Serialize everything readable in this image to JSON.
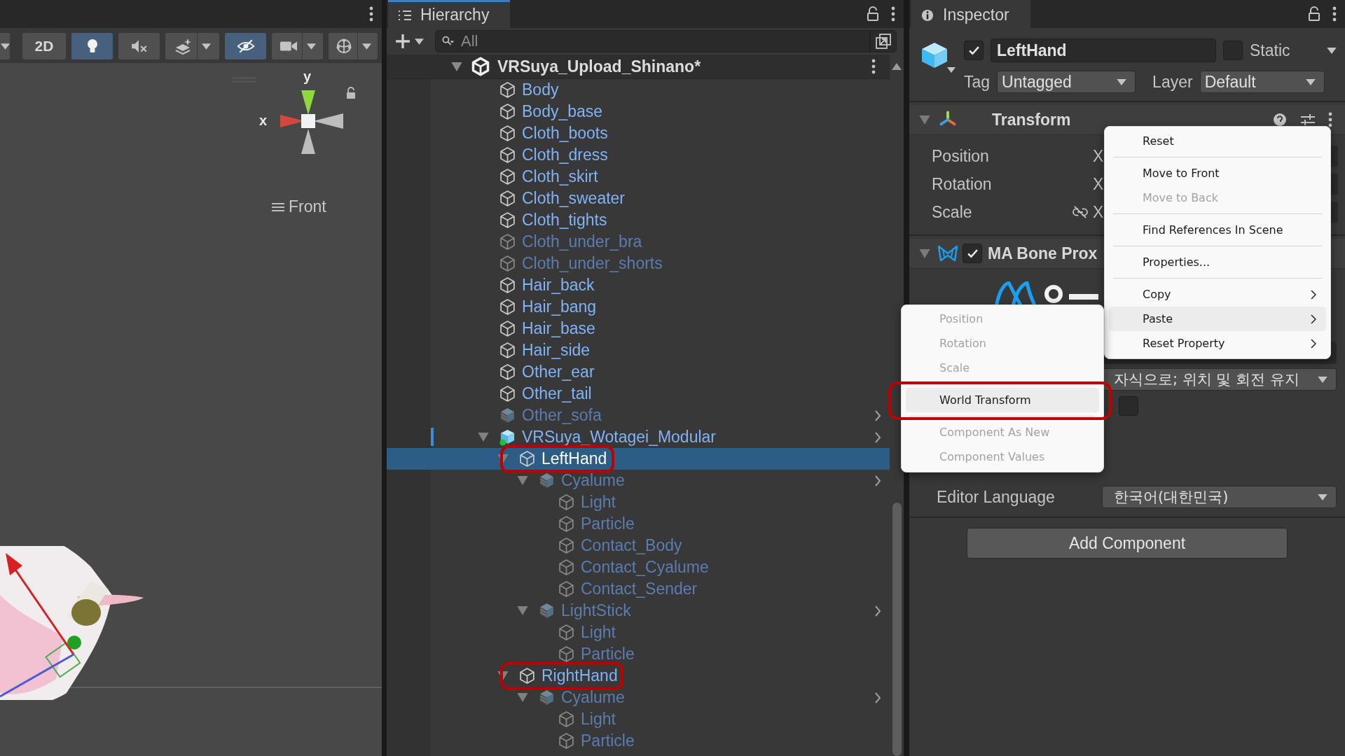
{
  "scene_view": {
    "toolbar": [
      {
        "kind": "caret",
        "on": false,
        "dropdown": true
      },
      {
        "kind": "text",
        "label": "2D",
        "on": false,
        "dropdown": false
      },
      {
        "kind": "light",
        "on": true,
        "dropdown": false
      },
      {
        "kind": "audio",
        "on": false,
        "dropdown": false
      },
      {
        "kind": "effects",
        "on": false,
        "dropdown": true
      },
      {
        "kind": "visibility",
        "on": true,
        "dropdown": false
      },
      {
        "kind": "camera",
        "on": false,
        "dropdown": true
      },
      {
        "kind": "gizmos",
        "on": false,
        "dropdown": true
      }
    ],
    "gizmo": {
      "y_label": "y",
      "x_label": "x",
      "view": "Front"
    }
  },
  "hierarchy": {
    "title": "Hierarchy",
    "focused": true,
    "search": {
      "placeholder": "All"
    },
    "scene": {
      "name": "VRSuya_Upload_Shinano*",
      "expanded": true
    },
    "items": [
      {
        "name": "Body",
        "kind": "object",
        "active": true,
        "selected": false,
        "marked": false
      },
      {
        "name": "Body_base",
        "kind": "object",
        "active": true,
        "selected": false,
        "marked": false
      },
      {
        "name": "Cloth_boots",
        "kind": "object",
        "active": true,
        "selected": false,
        "marked": false
      },
      {
        "name": "Cloth_dress",
        "kind": "object",
        "active": true,
        "selected": false,
        "marked": false
      },
      {
        "name": "Cloth_skirt",
        "kind": "object",
        "active": true,
        "selected": false,
        "marked": false
      },
      {
        "name": "Cloth_sweater",
        "kind": "object",
        "active": true,
        "selected": false,
        "marked": false
      },
      {
        "name": "Cloth_tights",
        "kind": "object",
        "active": true,
        "selected": false,
        "marked": false
      },
      {
        "name": "Cloth_under_bra",
        "kind": "object",
        "active": false,
        "selected": false,
        "marked": false
      },
      {
        "name": "Cloth_under_shorts",
        "kind": "object",
        "active": false,
        "selected": false,
        "marked": false
      },
      {
        "name": "Hair_back",
        "kind": "object",
        "active": true,
        "selected": false,
        "marked": false
      },
      {
        "name": "Hair_bang",
        "kind": "object",
        "active": true,
        "selected": false,
        "marked": false
      },
      {
        "name": "Hair_base",
        "kind": "object",
        "active": true,
        "selected": false,
        "marked": false
      },
      {
        "name": "Hair_side",
        "kind": "object",
        "active": true,
        "selected": false,
        "marked": false
      },
      {
        "name": "Other_ear",
        "kind": "object",
        "active": true,
        "selected": false,
        "marked": false
      },
      {
        "name": "Other_tail",
        "kind": "object",
        "active": true,
        "selected": false,
        "marked": false
      },
      {
        "name": "Other_sofa",
        "kind": "prefab",
        "active": false,
        "selected": false,
        "marked": false
      },
      {
        "name": "VRSuya_Wotagei_Modular",
        "kind": "prefab_root",
        "active": true,
        "selected": false,
        "marked": false,
        "expanded": true,
        "children": [
          {
            "name": "LeftHand",
            "kind": "object",
            "active": true,
            "selected": true,
            "marked": true,
            "expanded": true,
            "children": [
              {
                "name": "Cyalume",
                "kind": "prefab",
                "active": false,
                "selected": false,
                "marked": false,
                "expanded": true,
                "children": [
                  {
                    "name": "Light",
                    "kind": "object",
                    "active": false,
                    "selected": false,
                    "marked": false
                  },
                  {
                    "name": "Particle",
                    "kind": "object",
                    "active": false,
                    "selected": false,
                    "marked": false
                  },
                  {
                    "name": "Contact_Body",
                    "kind": "object",
                    "active": false,
                    "selected": false,
                    "marked": false
                  },
                  {
                    "name": "Contact_Cyalume",
                    "kind": "object",
                    "active": false,
                    "selected": false,
                    "marked": false
                  },
                  {
                    "name": "Contact_Sender",
                    "kind": "object",
                    "active": false,
                    "selected": false,
                    "marked": false
                  }
                ]
              },
              {
                "name": "LightStick",
                "kind": "prefab",
                "active": false,
                "selected": false,
                "marked": false,
                "expanded": true,
                "children": [
                  {
                    "name": "Light",
                    "kind": "object",
                    "active": false,
                    "selected": false,
                    "marked": false
                  },
                  {
                    "name": "Particle",
                    "kind": "object",
                    "active": false,
                    "selected": false,
                    "marked": false
                  }
                ]
              }
            ]
          },
          {
            "name": "RightHand",
            "kind": "object",
            "active": true,
            "selected": false,
            "marked": true,
            "expanded": true,
            "children": [
              {
                "name": "Cyalume",
                "kind": "prefab",
                "active": false,
                "selected": false,
                "marked": false,
                "expanded": true,
                "children": [
                  {
                    "name": "Light",
                    "kind": "object",
                    "active": false,
                    "selected": false,
                    "marked": false
                  },
                  {
                    "name": "Particle",
                    "kind": "object",
                    "active": false,
                    "selected": false,
                    "marked": false
                  }
                ]
              }
            ]
          }
        ]
      }
    ]
  },
  "inspector": {
    "title": "Inspector",
    "focused": false,
    "object": {
      "active": true,
      "name": "LeftHand",
      "static": false,
      "static_label": "Static",
      "tag_label": "Tag",
      "tag": "Untagged",
      "layer_label": "Layer",
      "layer": "Default"
    },
    "components": [
      {
        "kind": "transform",
        "title": "Transform",
        "expanded": true,
        "rows": [
          {
            "label": "Position",
            "axis": "X",
            "link": false
          },
          {
            "label": "Rotation",
            "axis": "X",
            "link": false
          },
          {
            "label": "Scale",
            "axis": "X",
            "link": true
          }
        ]
      },
      {
        "kind": "bone_proxy",
        "title": "MA Bone Prox",
        "expanded": true,
        "enabled": true,
        "option_checked": false,
        "mode": "자식으로; 위치 및 회전 유지",
        "language_label": "Editor Language",
        "language": "한국어(대한민국)"
      }
    ],
    "add_component": "Add Component"
  },
  "context_menu": {
    "items": [
      {
        "kind": "item",
        "label": "Reset",
        "enabled": true,
        "highlighted": false,
        "submenu": false,
        "marked": false
      },
      {
        "kind": "separator"
      },
      {
        "kind": "item",
        "label": "Move to Front",
        "enabled": true,
        "highlighted": false,
        "submenu": false,
        "marked": false
      },
      {
        "kind": "item",
        "label": "Move to Back",
        "enabled": false,
        "highlighted": false,
        "submenu": false,
        "marked": false
      },
      {
        "kind": "separator"
      },
      {
        "kind": "item",
        "label": "Find References In Scene",
        "enabled": true,
        "highlighted": false,
        "submenu": false,
        "marked": false
      },
      {
        "kind": "separator"
      },
      {
        "kind": "item",
        "label": "Properties...",
        "enabled": true,
        "highlighted": false,
        "submenu": false,
        "marked": false
      },
      {
        "kind": "separator"
      },
      {
        "kind": "item",
        "label": "Copy",
        "enabled": true,
        "highlighted": false,
        "submenu": true,
        "marked": false
      },
      {
        "kind": "item",
        "label": "Paste",
        "enabled": true,
        "highlighted": true,
        "submenu": true,
        "marked": false
      },
      {
        "kind": "item",
        "label": "Reset Property",
        "enabled": true,
        "highlighted": false,
        "submenu": true,
        "marked": false
      }
    ]
  },
  "submenu": {
    "items": [
      {
        "kind": "item",
        "label": "Position",
        "enabled": false,
        "highlighted": false,
        "submenu": false,
        "marked": false
      },
      {
        "kind": "item",
        "label": "Rotation",
        "enabled": false,
        "highlighted": false,
        "submenu": false,
        "marked": false
      },
      {
        "kind": "item",
        "label": "Scale",
        "enabled": false,
        "highlighted": false,
        "submenu": false,
        "marked": false
      },
      {
        "kind": "separator"
      },
      {
        "kind": "item",
        "label": "World Transform",
        "enabled": true,
        "highlighted": true,
        "submenu": false,
        "marked": true
      },
      {
        "kind": "separator"
      },
      {
        "kind": "item",
        "label": "Component As New",
        "enabled": false,
        "highlighted": false,
        "submenu": false,
        "marked": false
      },
      {
        "kind": "item",
        "label": "Component Values",
        "enabled": false,
        "highlighted": false,
        "submenu": false,
        "marked": false
      }
    ]
  }
}
